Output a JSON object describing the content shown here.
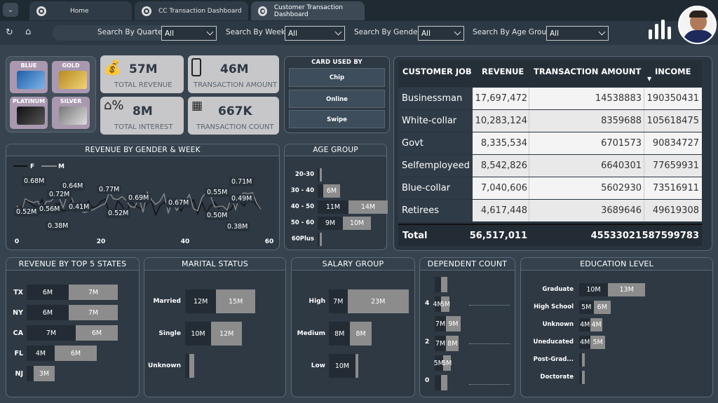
{
  "tabs": [
    {
      "label": "Home"
    },
    {
      "label": "CC Transaction Dashboard"
    },
    {
      "label": "Customer Transaction Dashboard"
    }
  ],
  "filters": {
    "quarter_label": "Search By Quarter",
    "quarter_value": "All",
    "week_label": "Search By Week",
    "week_value": "All",
    "gender_label": "Search By Gender",
    "gender_value": "All",
    "age_label": "Search By Age Group",
    "age_value": "All"
  },
  "cards": [
    "BLUE",
    "GOLD",
    "PLATINUM",
    "SILVER"
  ],
  "kpis": {
    "revenue": {
      "value": "57M",
      "label": "TOTAL REVENUE"
    },
    "transaction_amount": {
      "value": "46M",
      "label": "TRANSACTION AMOUNT"
    },
    "interest": {
      "value": "8M",
      "label": "TOTAL INTEREST"
    },
    "transaction_count": {
      "value": "667K",
      "label": "TRANSACTION COUNT"
    }
  },
  "card_used_by": {
    "title": "CARD USED BY",
    "options": [
      "Chip",
      "Online",
      "Swipe"
    ]
  },
  "job_table": {
    "headers": [
      "CUSTOMER JOB",
      "REVENUE",
      "TRANSACTION AMOUNT",
      "INCOME"
    ],
    "rows": [
      [
        "Businessman",
        "17,697,472",
        "14538883",
        "190350431"
      ],
      [
        "White-collar",
        "10,283,124",
        "8359688",
        "105618475"
      ],
      [
        "Govt",
        "8,335,534",
        "6701573",
        "90834727"
      ],
      [
        "Selfemployeed",
        "8,542,826",
        "6640301",
        "77659931"
      ],
      [
        "Blue-collar",
        "7,040,606",
        "5602930",
        "73516911"
      ],
      [
        "Retirees",
        "4,617,448",
        "3689646",
        "49619308"
      ]
    ],
    "total": [
      "Total",
      "56,517,011",
      "45533021",
      "587599783"
    ]
  },
  "colors": {
    "bg": "#37434f",
    "panel": "#2e3944",
    "dark_bar": "#232c34",
    "light_bar": "#8c8c8c",
    "kpi": "#c7c6c8"
  },
  "chart_data": [
    {
      "type": "line",
      "title": "REVENUE BY GENDER & WEEK",
      "xlabel": "",
      "ylabel": "",
      "series": [
        {
          "name": "F"
        },
        {
          "name": "M"
        }
      ],
      "x_ticks": [
        "0",
        "20",
        "40",
        "60"
      ],
      "xlim": [
        0,
        60
      ],
      "annotations": [
        "0.68M",
        "0.64M",
        "0.72M",
        "0.77M",
        "0.69M",
        "0.67M",
        "0.55M",
        "0.71M",
        "0.49M",
        "0.52M",
        "0.56M",
        "0.41M",
        "0.52M",
        "0.50M",
        "0.38M",
        "0.38M"
      ]
    },
    {
      "type": "bar",
      "title": "AGE GROUP",
      "categories": [
        "20-30",
        "30 - 40",
        "40 - 50",
        "50 - 60",
        "60Plus"
      ],
      "series": [
        {
          "values": [
            0.1,
            2,
            11,
            9,
            0.5
          ]
        },
        {
          "values": [
            0.1,
            6,
            14,
            10,
            0.1
          ]
        }
      ],
      "labels": [
        [
          "",
          ""
        ],
        [
          "",
          "6M"
        ],
        [
          "11M",
          "14M"
        ],
        [
          "9M",
          "10M"
        ],
        [
          "",
          ""
        ]
      ]
    },
    {
      "type": "bar",
      "title": "REVENUE BY TOP 5 STATES",
      "categories": [
        "TX",
        "NY",
        "CA",
        "FL",
        "NJ"
      ],
      "series": [
        {
          "values": [
            6,
            6,
            7,
            4,
            1
          ]
        },
        {
          "values": [
            7,
            7,
            6,
            6,
            3
          ]
        }
      ],
      "labels": [
        [
          "6M",
          "7M"
        ],
        [
          "6M",
          "7M"
        ],
        [
          "7M",
          "6M"
        ],
        [
          "4M",
          "6M"
        ],
        [
          "",
          "3M"
        ]
      ]
    },
    {
      "type": "bar",
      "title": "MARITAL STATUS",
      "categories": [
        "Married",
        "Single",
        "Unknown"
      ],
      "series": [
        {
          "values": [
            12,
            10,
            1.5
          ]
        },
        {
          "values": [
            15,
            12,
            2
          ]
        }
      ],
      "labels": [
        [
          "12M",
          "15M"
        ],
        [
          "10M",
          "12M"
        ],
        [
          "",
          ""
        ]
      ]
    },
    {
      "type": "bar",
      "title": "SALARY GROUP",
      "categories": [
        "High",
        "Medium",
        "Low"
      ],
      "series": [
        {
          "values": [
            7,
            8,
            10
          ]
        },
        {
          "values": [
            23,
            8,
            0.5
          ]
        }
      ],
      "labels": [
        [
          "7M",
          "23M"
        ],
        [
          "8M",
          "8M"
        ],
        [
          "10M",
          ""
        ]
      ]
    },
    {
      "type": "bar",
      "title": "DEPENDENT COUNT",
      "y_ticks": [
        "4",
        "2",
        "0"
      ],
      "series": [
        {
          "values": [
            1,
            4,
            7,
            7,
            5,
            2
          ]
        },
        {
          "values": [
            1,
            5,
            9,
            8,
            5,
            3
          ]
        }
      ],
      "labels": [
        [
          "",
          ""
        ],
        [
          "4M",
          "5M"
        ],
        [
          "7M",
          "9M"
        ],
        [
          "7M",
          "8M"
        ],
        [
          "5M",
          "5M"
        ],
        [
          "",
          ""
        ]
      ]
    },
    {
      "type": "bar",
      "title": "EDUCATION LEVEL",
      "categories": [
        "Graduate",
        "High School",
        "Unknown",
        "Uneducated",
        "Post-Grad...",
        "Doctorate"
      ],
      "series": [
        {
          "values": [
            10,
            5,
            4,
            4,
            1,
            1
          ]
        },
        {
          "values": [
            13,
            6,
            4,
            5,
            1,
            1
          ]
        }
      ],
      "labels": [
        [
          "10M",
          "13M"
        ],
        [
          "5M",
          "6M"
        ],
        [
          "4M",
          "4M"
        ],
        [
          "4M",
          "5M"
        ],
        [
          "",
          ""
        ],
        [
          "",
          ""
        ]
      ]
    }
  ]
}
